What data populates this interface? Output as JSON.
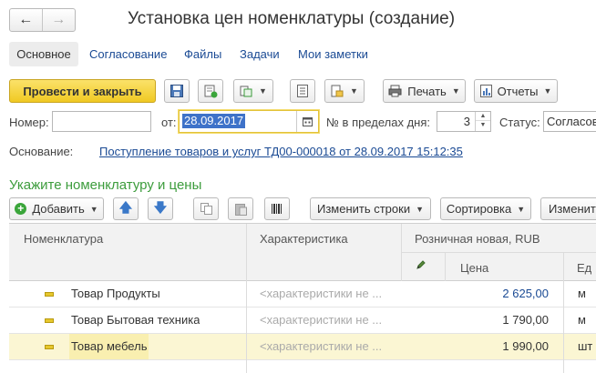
{
  "title": "Установка цен номенклатуры (создание)",
  "tabs": [
    {
      "label": "Основное"
    },
    {
      "label": "Согласование"
    },
    {
      "label": "Файлы"
    },
    {
      "label": "Задачи"
    },
    {
      "label": "Мои заметки"
    }
  ],
  "toolbar": {
    "post_close_label": "Провести и закрыть",
    "print_label": "Печать",
    "reports_label": "Отчеты"
  },
  "form": {
    "number_label": "Номер:",
    "number_value": "",
    "from_label": "от:",
    "date_value": "28.09.2017",
    "days_label": "№ в пределах дня:",
    "days_value": "3",
    "status_label": "Статус:",
    "status_value": "Согласова",
    "basis_label": "Основание:",
    "basis_link": "Поступление товаров и услуг ТД00-000018 от 28.09.2017 15:12:35"
  },
  "section_title": "Укажите номенклатуру и цены",
  "table_toolbar": {
    "add_label": "Добавить",
    "change_rows_label": "Изменить строки",
    "sort_label": "Сортировка",
    "change_label": "Изменит"
  },
  "table": {
    "headers": {
      "nomenclature": "Номенклатура",
      "characteristic": "Характеристика",
      "retail": "Розничная новая, RUB",
      "price": "Цена",
      "unit": "Ед"
    },
    "rows": [
      {
        "name": "Товар Продукты",
        "characteristic": "<характеристики не ...",
        "price": "2 625,00",
        "unit": "м"
      },
      {
        "name": "Товар Бытовая техника",
        "characteristic": "<характеристики не ...",
        "price": "1 790,00",
        "unit": "м"
      },
      {
        "name": "Товар мебель",
        "characteristic": "<характеристики не ...",
        "price": "1 990,00",
        "unit": "шт"
      }
    ]
  },
  "colors": {
    "primary_button": "#f5d33a",
    "section_title": "#3c9c3c",
    "link": "#1a4a94",
    "selected_row": "#fbf6d3"
  }
}
